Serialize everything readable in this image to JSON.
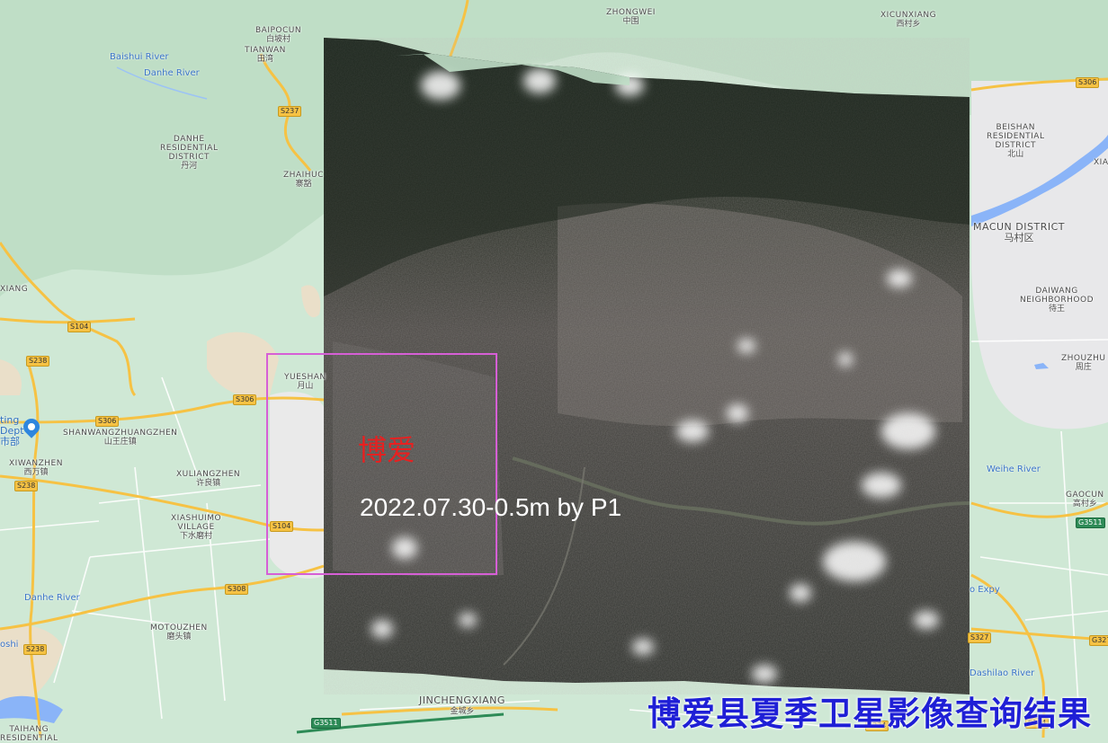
{
  "map": {
    "overlay_title": "博爱县夏季卫星影像查询结果",
    "aoi_name": "博爱",
    "imagery_caption": "2022.07.30-0.5m by P1",
    "poi_label": "ting\nDept\n市部"
  },
  "places": {
    "baipocun": {
      "en": "BAIPOCUN",
      "cn": "白坡村"
    },
    "tianwan": {
      "en": "TIANWAN",
      "cn": "田湾"
    },
    "zhongwei": {
      "en": "ZHONGWEI",
      "cn": "中围"
    },
    "xicunxiang": {
      "en": "XICUNXIANG",
      "cn": "西村乡"
    },
    "danhe": {
      "en": "DANHE\nRESIDENTIAL\nDISTRICT",
      "cn": "丹河"
    },
    "zhaihuc": {
      "en": "ZHAIHUC",
      "cn": "寨豁"
    },
    "beishan": {
      "en": "BEISHAN\nRESIDENTIAL\nDISTRICT",
      "cn": "北山"
    },
    "macun": {
      "en": "MACUN DISTRICT",
      "cn": "马村区"
    },
    "daiwang": {
      "en": "DAIWANG\nNEIGHBORHOOD",
      "cn": "待王"
    },
    "zhouzhu": {
      "en": "ZHOUZHU",
      "cn": "周庄"
    },
    "gaocun": {
      "en": "GAOCUN",
      "cn": "高村乡"
    },
    "yueshan": {
      "en": "YUESHAN",
      "cn": "月山"
    },
    "shanwang": {
      "en": "SHANWANGZHUANGZHEN",
      "cn": "山王庄镇"
    },
    "xiwanzhen": {
      "en": "XIWANZHEN",
      "cn": "西万镇"
    },
    "xiuliang": {
      "en": "XULIANGZHEN",
      "cn": "许良镇"
    },
    "xiashuimo": {
      "en": "XIASHUIMO\nVILLAGE",
      "cn": "下水磨村"
    },
    "motouzhen": {
      "en": "MOTOUZHEN",
      "cn": "磨头镇"
    },
    "jincheng": {
      "en": "JINCHENGXIANG",
      "cn": "金城乡"
    },
    "taihang": {
      "en": "TAIHANG\nRESIDENTIAL",
      "cn": ""
    },
    "xiang_left": {
      "en": "XIANG",
      "cn": ""
    },
    "xia_right": {
      "en": "XIA",
      "cn": ""
    }
  },
  "rivers": {
    "baishui": "Baishui River",
    "danhe_top": "Danhe River",
    "danhe_bottom": "Danhe River",
    "weihe": "Weihe River",
    "dashilao": "Dashilao River",
    "expy": "o Expy",
    "oshi": "oshi"
  },
  "roads": {
    "s237": "S237",
    "s104a": "S104",
    "s238a": "S238",
    "s306a": "S306",
    "s306b": "S306",
    "s238b": "S238",
    "s104b": "S104",
    "s308": "S308",
    "s238c": "S238",
    "s306r": "S306",
    "g3511a": "G3511",
    "g3511b": "G3511",
    "s327": "S327",
    "s234": "S234",
    "s104c": "S104",
    "g327": "G327"
  },
  "colors": {
    "land": "#cfe8d5",
    "urban": "#ececec",
    "sand": "#eadfc9",
    "road": "#f6c244",
    "water": "#8ab4f8",
    "aoi_border": "#d65fd6",
    "aoi_text": "#e82020",
    "title": "#1f1fd6"
  }
}
